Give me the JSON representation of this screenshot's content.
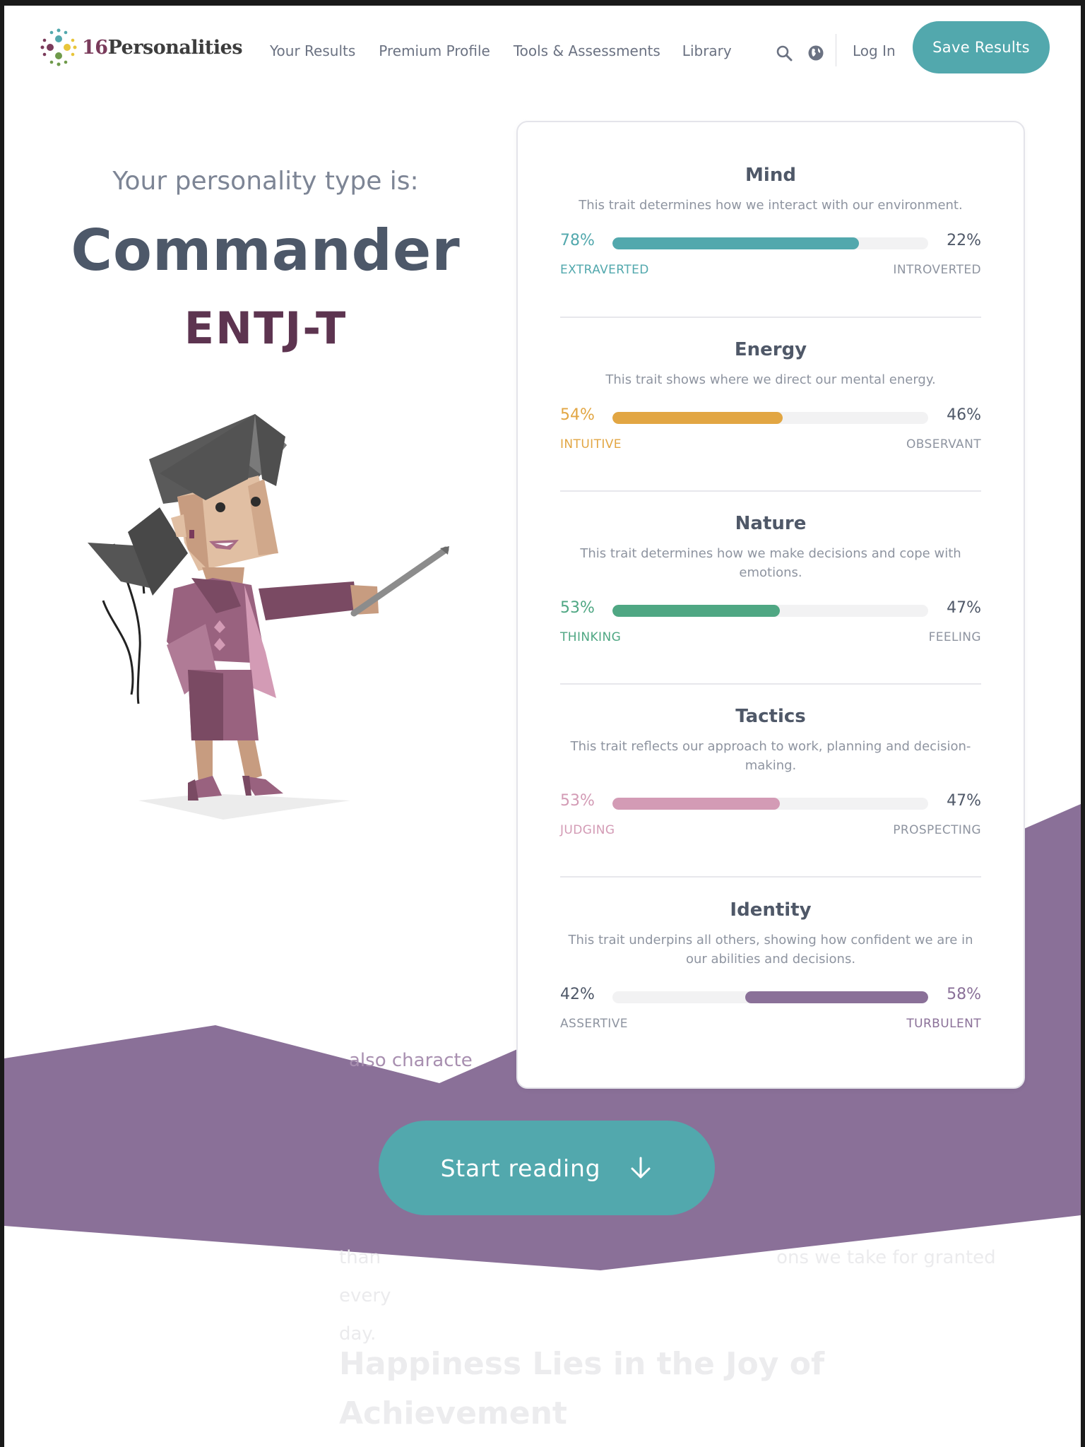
{
  "header": {
    "logo": {
      "number": "16",
      "word": "Personalities"
    },
    "nav": [
      "Your Results",
      "Premium Profile",
      "Tools & Assessments",
      "Library"
    ],
    "login_label": "Log In",
    "save_label": "Save Results",
    "icons": [
      "search-icon",
      "globe-icon"
    ]
  },
  "hero": {
    "intro": "Your personality type is:",
    "type_name": "Commander",
    "type_code": "ENTJ-T"
  },
  "traits": [
    {
      "title": "Mind",
      "desc": "This trait determines how we interact with our environment.",
      "left_pct": "78%",
      "right_pct": "22%",
      "left_label": "EXTRAVERTED",
      "right_label": "INTROVERTED",
      "fill": 0.78,
      "side": "left",
      "color": "#52a8ad"
    },
    {
      "title": "Energy",
      "desc": "This trait shows where we direct our mental energy.",
      "left_pct": "54%",
      "right_pct": "46%",
      "left_label": "INTUITIVE",
      "right_label": "OBSERVANT",
      "fill": 0.54,
      "side": "left",
      "color": "#e2a643"
    },
    {
      "title": "Nature",
      "desc": "This trait determines how we make decisions and cope with emotions.",
      "left_pct": "53%",
      "right_pct": "47%",
      "left_label": "THINKING",
      "right_label": "FEELING",
      "fill": 0.53,
      "side": "left",
      "color": "#4fa783"
    },
    {
      "title": "Tactics",
      "desc": "This trait reflects our approach to work, planning and decision-making.",
      "left_pct": "53%",
      "right_pct": "47%",
      "left_label": "JUDGING",
      "right_label": "PROSPECTING",
      "fill": 0.53,
      "side": "left",
      "color": "#d39bb5"
    },
    {
      "title": "Identity",
      "desc": "This trait underpins all others, showing how confident we are in our abilities and decisions.",
      "left_pct": "42%",
      "right_pct": "58%",
      "left_label": "ASSERTIVE",
      "right_label": "TURBULENT",
      "fill": 0.58,
      "side": "right",
      "color": "#8a7098"
    }
  ],
  "cta": {
    "label": "Start reading"
  },
  "background_text": {
    "fragment_1": "also characte",
    "fragment_2": "than",
    "fragment_3": "ons we take for granted every",
    "fragment_4": "day.",
    "heading": "Happiness Lies in the Joy of Achievement"
  },
  "colors": {
    "accent_teal": "#52a8ad",
    "purple_band": "#8a7098",
    "type_code": "#5d3450"
  }
}
